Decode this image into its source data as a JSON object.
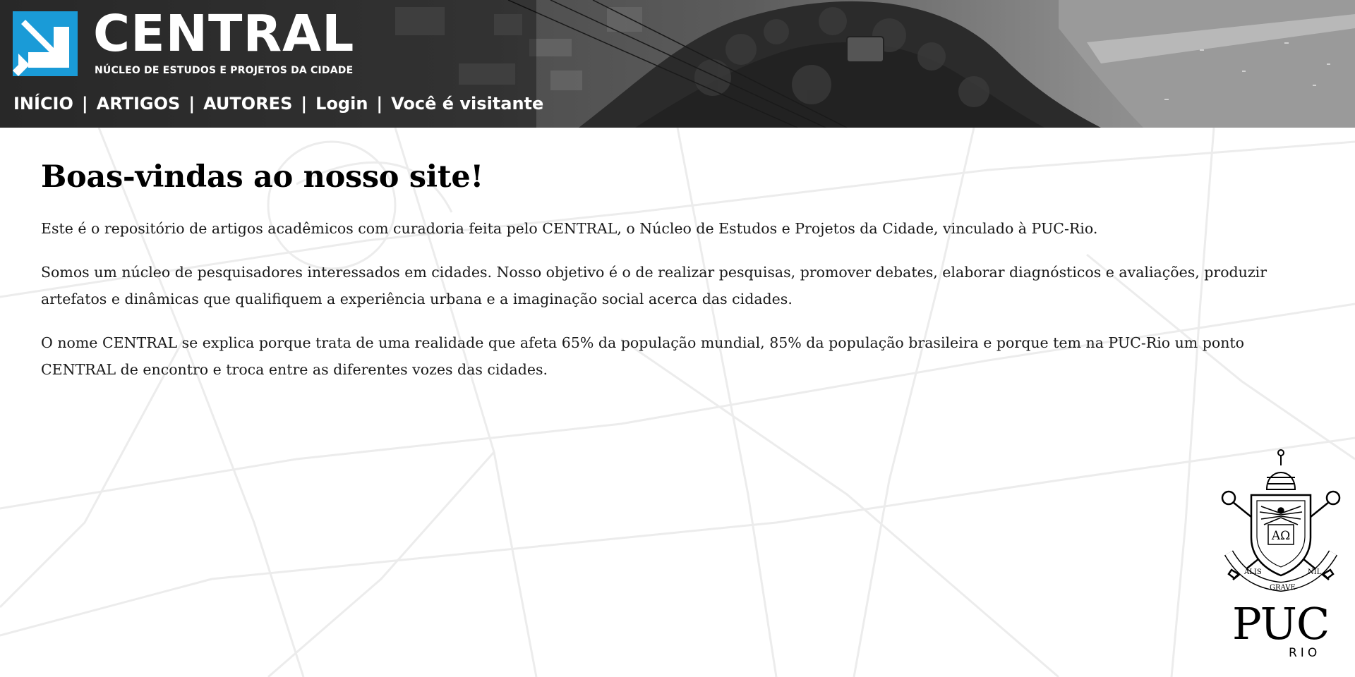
{
  "header": {
    "brand_name": "CENTRAL",
    "brand_subtitle": "NÚCLEO DE ESTUDOS E PROJETOS DA CIDADE",
    "nav": [
      {
        "label": "INÍCIO"
      },
      {
        "label": "ARTIGOS"
      },
      {
        "label": "AUTORES"
      },
      {
        "label": "Login"
      },
      {
        "label": "Você é visitante"
      }
    ],
    "separator": "|"
  },
  "main": {
    "title": "Boas-vindas ao nosso site!",
    "paragraphs": [
      "Este é o repositório de artigos acadêmicos com curadoria feita pelo CENTRAL, o Núcleo de Estudos e Projetos da Cidade, vinculado à PUC-Rio.",
      "Somos um núcleo de pesquisadores interessados em cidades. Nosso objetivo é o de realizar pesquisas, promover debates, elaborar diagnósticos e avaliações, produzir artefatos e dinâmicas que qualifiquem a experiência urbana e a imaginação social acerca das cidades.",
      "O nome CENTRAL se explica porque trata de uma realidade que afeta 65% da população mundial, 85% da população brasileira e porque tem na PUC-Rio um ponto CENTRAL de encontro e troca entre as diferentes vozes das cidades."
    ]
  },
  "footer_logo": {
    "main": "PUC",
    "sub": "RIO",
    "seal_text": [
      "ALIS",
      "GRAVE",
      "NIL"
    ],
    "seal_letters": "ΑΩ"
  },
  "colors": {
    "logo_accent": "#1a9bd7",
    "nav_text": "#ffffff",
    "page_bg": "#ffffff",
    "map_lines": "#ebebeb"
  },
  "icons": [
    "central-logo-icon",
    "puc-rio-seal-icon"
  ]
}
